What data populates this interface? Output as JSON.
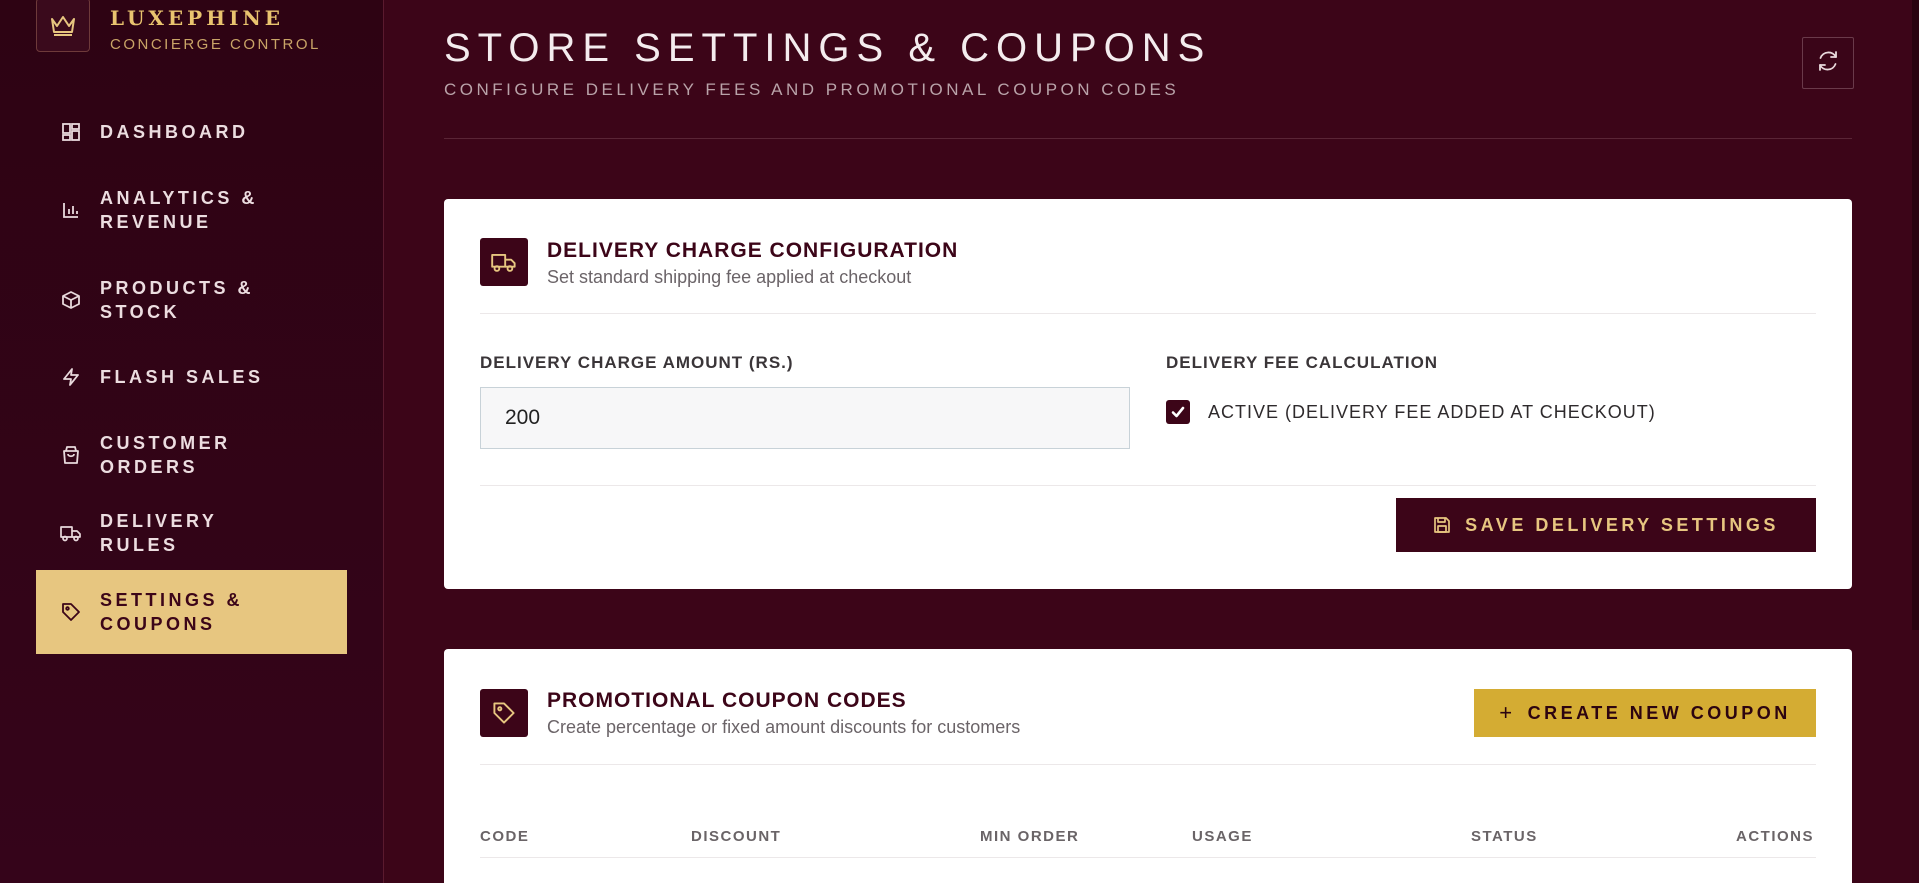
{
  "brand": {
    "name": "LUXEPHINE",
    "subtitle": "CONCIERGE CONTROL",
    "icon": "crown-icon"
  },
  "sidebar": {
    "items": [
      {
        "label": "DASHBOARD",
        "icon": "dashboard-grid-icon"
      },
      {
        "label": "ANALYTICS & REVENUE",
        "icon": "bar-chart-icon"
      },
      {
        "label": "PRODUCTS & STOCK",
        "icon": "box-icon"
      },
      {
        "label": "FLASH SALES",
        "icon": "lightning-icon"
      },
      {
        "label": "CUSTOMER ORDERS",
        "icon": "shopping-bag-icon"
      },
      {
        "label": "DELIVERY RULES",
        "icon": "truck-icon"
      },
      {
        "label": "SETTINGS & COUPONS",
        "icon": "tag-icon",
        "active": true
      }
    ]
  },
  "header": {
    "title": "STORE SETTINGS & COUPONS",
    "subtitle": "CONFIGURE DELIVERY FEES AND PROMOTIONAL COUPON CODES",
    "refresh_icon": "refresh-icon"
  },
  "delivery": {
    "title": "DELIVERY CHARGE CONFIGURATION",
    "description": "Set standard shipping fee applied at checkout",
    "amount_label": "DELIVERY CHARGE AMOUNT (RS.)",
    "amount_value": "200",
    "calc_label": "DELIVERY FEE CALCULATION",
    "active_checked": true,
    "active_label": "ACTIVE (DELIVERY FEE ADDED AT CHECKOUT)",
    "save_label": "SAVE DELIVERY SETTINGS"
  },
  "coupons": {
    "title": "PROMOTIONAL COUPON CODES",
    "description": "Create percentage or fixed amount discounts for customers",
    "create_label": "CREATE NEW COUPON",
    "columns": [
      "CODE",
      "DISCOUNT",
      "MIN ORDER",
      "USAGE",
      "STATUS",
      "ACTIONS"
    ]
  },
  "colors": {
    "primary": "#3c0518",
    "gold": "#e7c680",
    "gold_button": "#d4ac33",
    "background": "#3c0518"
  }
}
